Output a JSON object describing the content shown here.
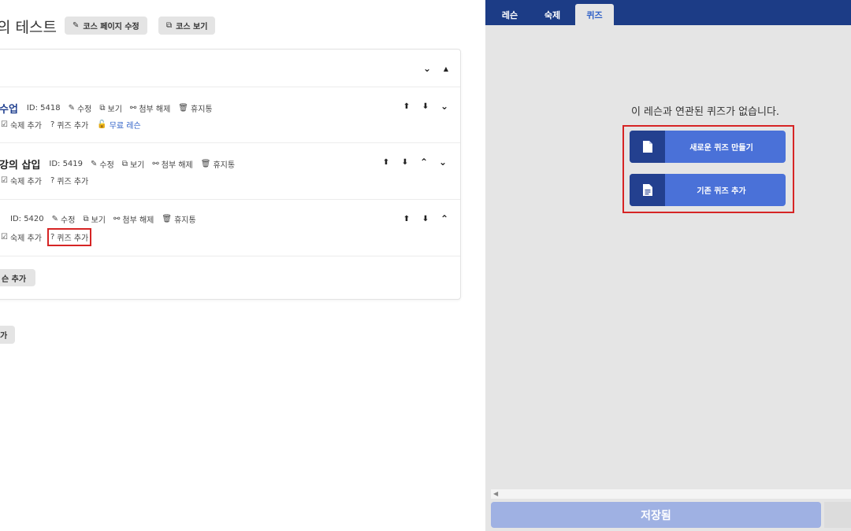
{
  "course": {
    "title": "의 테스트",
    "edit_page_label": "코스 페이지 수정",
    "view_label": "코스 보기"
  },
  "lessons": [
    {
      "title": "수업",
      "id_text": "ID: 5418",
      "edit_label": "수정",
      "view_label": "보기",
      "detach_label": "첨부 해제",
      "trash_label": "휴지통",
      "homework_label": "숙제 추가",
      "quiz_label": "퀴즈 추가",
      "free_label": "무료 레슨"
    },
    {
      "title": "강의 삽입",
      "id_text": "ID: 5419",
      "edit_label": "수정",
      "view_label": "보기",
      "detach_label": "첨부 해제",
      "trash_label": "휴지통",
      "homework_label": "숙제 추가",
      "quiz_label": "퀴즈 추가"
    },
    {
      "title": "",
      "id_text": "ID: 5420",
      "edit_label": "수정",
      "view_label": "보기",
      "detach_label": "첨부 해제",
      "trash_label": "휴지통",
      "homework_label": "숙제 추가",
      "quiz_label": "퀴즈 추가"
    }
  ],
  "add_lesson_label": "슨 추가",
  "add_section_label": "가",
  "panel": {
    "tabs": [
      "레슨",
      "숙제",
      "퀴즈"
    ],
    "active_tab": "퀴즈",
    "empty_message": "이 레슨과 연관된 퀴즈가 없습니다.",
    "new_quiz_label": "새로운 퀴즈 만들기",
    "existing_quiz_label": "기존 퀴즈 추가",
    "save_label": "저장됨"
  },
  "icons": [
    "edit-icon",
    "external-link-icon",
    "unlink-icon",
    "trash-icon",
    "question-circle-icon",
    "unlock-icon",
    "arrow-circle-up-icon",
    "arrow-circle-down-icon",
    "chevron-down-icon",
    "chevron-up-icon",
    "file-icon",
    "file-text-icon"
  ],
  "colors": {
    "brand_navy": "#1c3c86",
    "button_blue": "#4a71d8",
    "highlight_red": "#d62424",
    "link_blue": "#2d5fc7",
    "save_disabled": "#9fb1e3"
  }
}
